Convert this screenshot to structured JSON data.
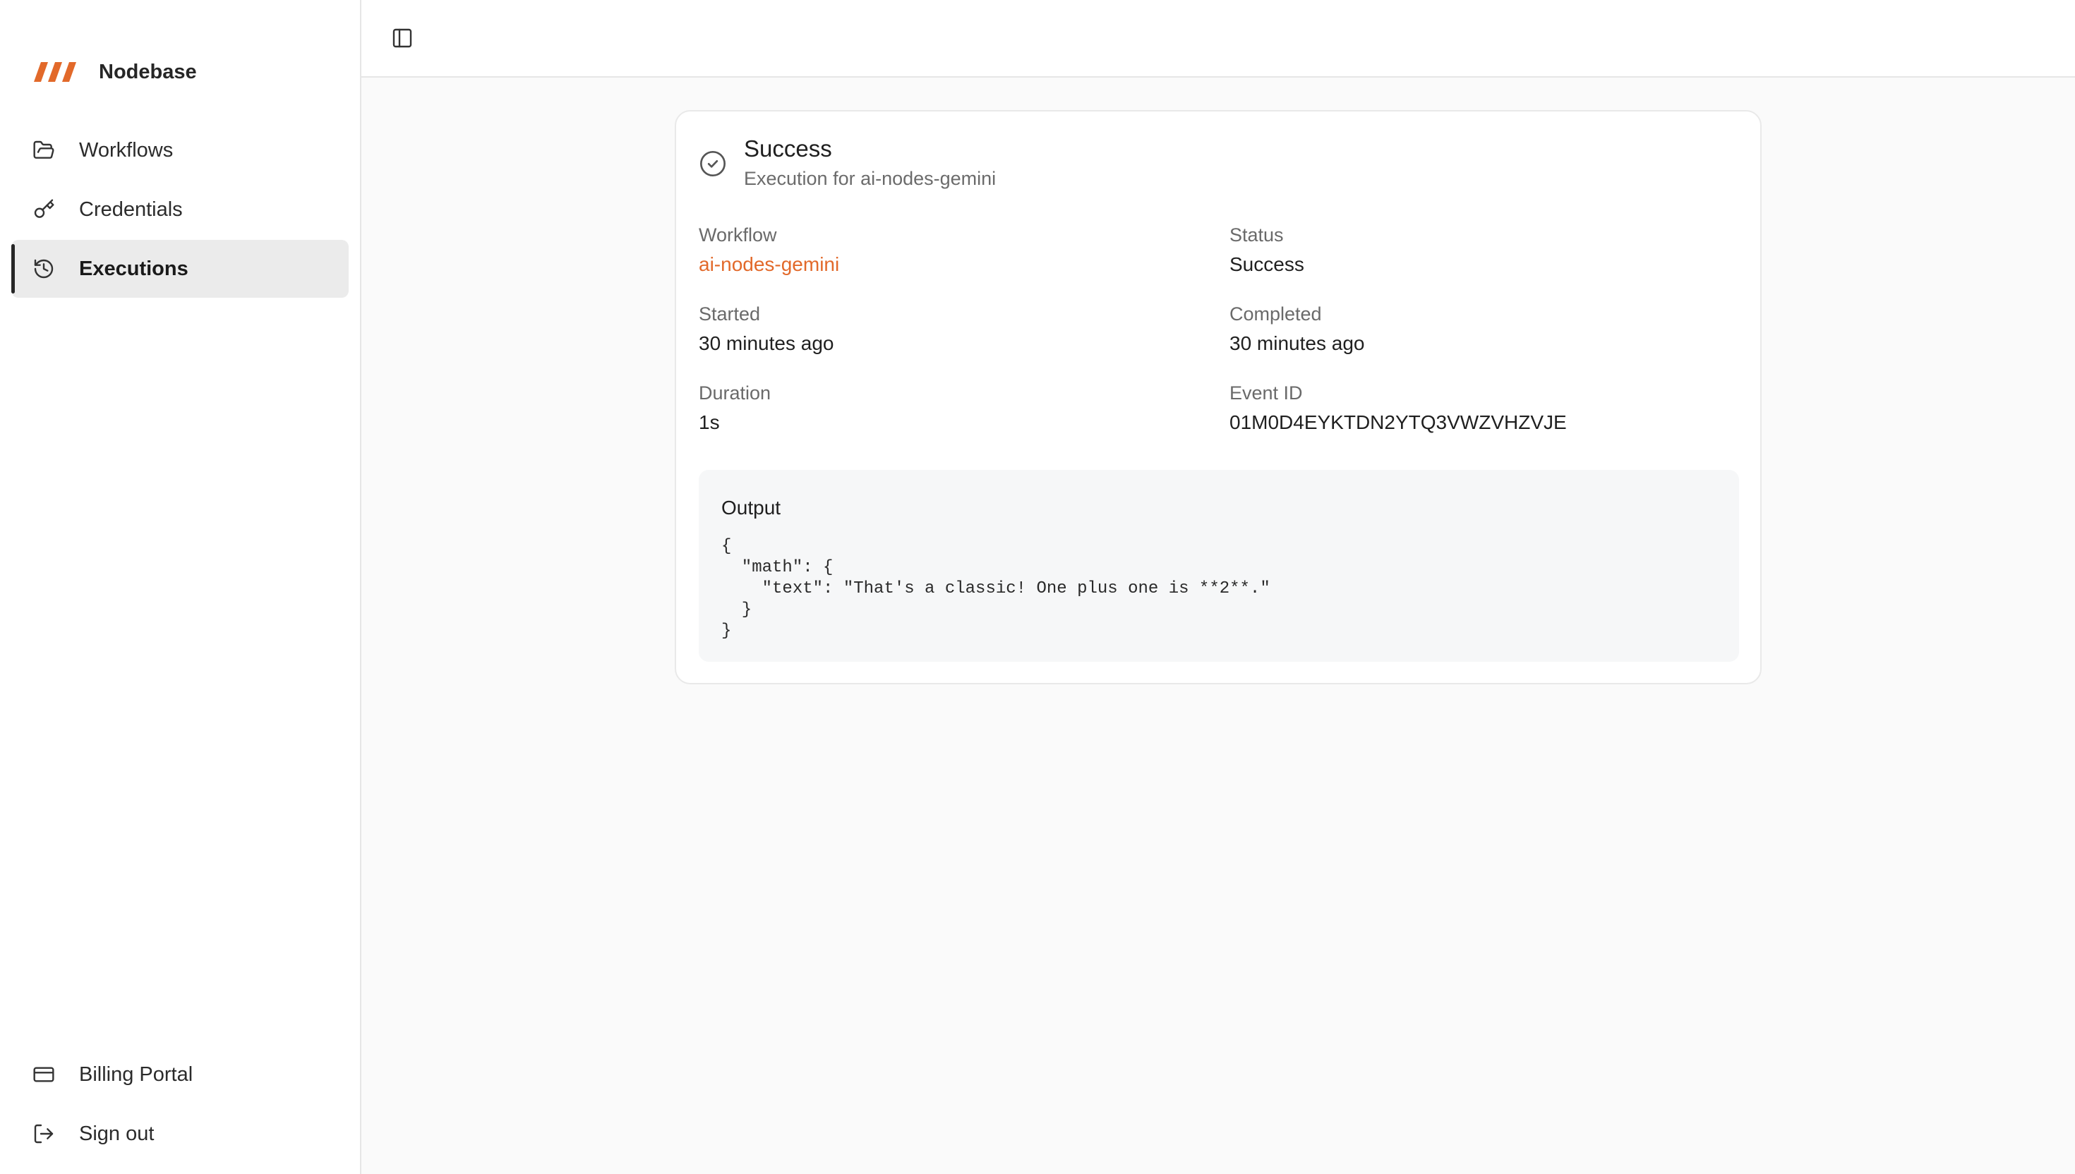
{
  "app": {
    "name": "Nodebase",
    "brand_color": "#e2692a"
  },
  "sidebar": {
    "items": [
      {
        "label": "Workflows",
        "icon": "folder-open-icon",
        "active": false
      },
      {
        "label": "Credentials",
        "icon": "key-icon",
        "active": false
      },
      {
        "label": "Executions",
        "icon": "history-icon",
        "active": true
      }
    ],
    "footer_items": [
      {
        "label": "Billing Portal",
        "icon": "credit-card-icon"
      },
      {
        "label": "Sign out",
        "icon": "log-out-icon"
      }
    ]
  },
  "topbar": {
    "toggle_icon": "panel-left-icon"
  },
  "execution": {
    "status_icon": "circle-check-icon",
    "title": "Success",
    "subtitle": "Execution for ai-nodes-gemini",
    "fields": {
      "workflow": {
        "label": "Workflow",
        "value": "ai-nodes-gemini"
      },
      "status": {
        "label": "Status",
        "value": "Success"
      },
      "started": {
        "label": "Started",
        "value": "30 minutes ago"
      },
      "completed": {
        "label": "Completed",
        "value": "30 minutes ago"
      },
      "duration": {
        "label": "Duration",
        "value": "1s"
      },
      "event_id": {
        "label": "Event ID",
        "value": "01M0D4EYKTDN2YTQ3VWZVHZVJE"
      }
    },
    "output": {
      "title": "Output",
      "code": "{\n  \"math\": {\n    \"text\": \"That's a classic! One plus one is **2**.\"\n  }\n}"
    }
  }
}
